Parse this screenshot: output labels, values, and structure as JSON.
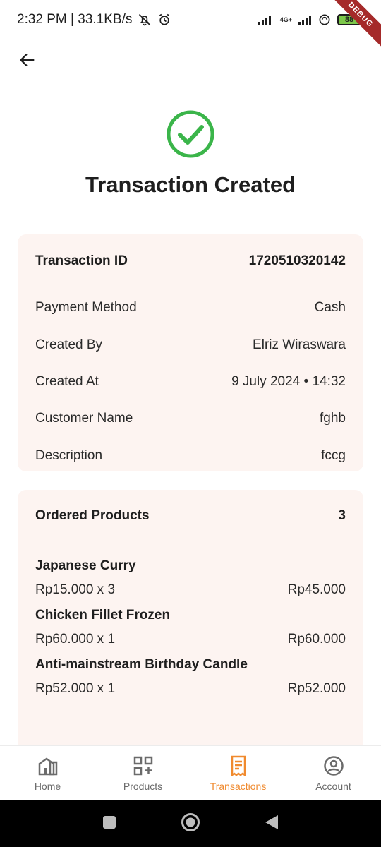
{
  "status_bar": {
    "time_speed": "2:32 PM | 33.1KB/s",
    "network": "4G+",
    "battery": "88",
    "debug_label": "DEBUG"
  },
  "header": {
    "title": "Transaction Created"
  },
  "transaction": {
    "id_label": "Transaction ID",
    "id_value": "1720510320142",
    "rows": [
      {
        "label": "Payment Method",
        "value": "Cash"
      },
      {
        "label": "Created By",
        "value": "Elriz Wiraswara"
      },
      {
        "label": "Created At",
        "value": "9 July 2024 • 14:32"
      },
      {
        "label": "Customer Name",
        "value": "fghb"
      },
      {
        "label": "Description",
        "value": "fccg"
      }
    ]
  },
  "ordered_products": {
    "title": "Ordered Products",
    "count": "3",
    "items": [
      {
        "name": "Japanese Curry",
        "price_qty": "Rp15.000 x 3",
        "total": "Rp45.000"
      },
      {
        "name": "Chicken Fillet Frozen",
        "price_qty": "Rp60.000 x 1",
        "total": "Rp60.000"
      },
      {
        "name": "Anti-mainstream Birthday Candle",
        "price_qty": "Rp52.000 x 1",
        "total": "Rp52.000"
      }
    ]
  },
  "bottom_nav": {
    "items": [
      {
        "label": "Home",
        "icon": "home-icon"
      },
      {
        "label": "Products",
        "icon": "qr-icon"
      },
      {
        "label": "Transactions",
        "icon": "receipt-icon",
        "active": true
      },
      {
        "label": "Account",
        "icon": "account-icon"
      }
    ]
  },
  "colors": {
    "accent": "#f08a2e",
    "success": "#3bb54a",
    "card_bg": "#fdf4f1"
  }
}
